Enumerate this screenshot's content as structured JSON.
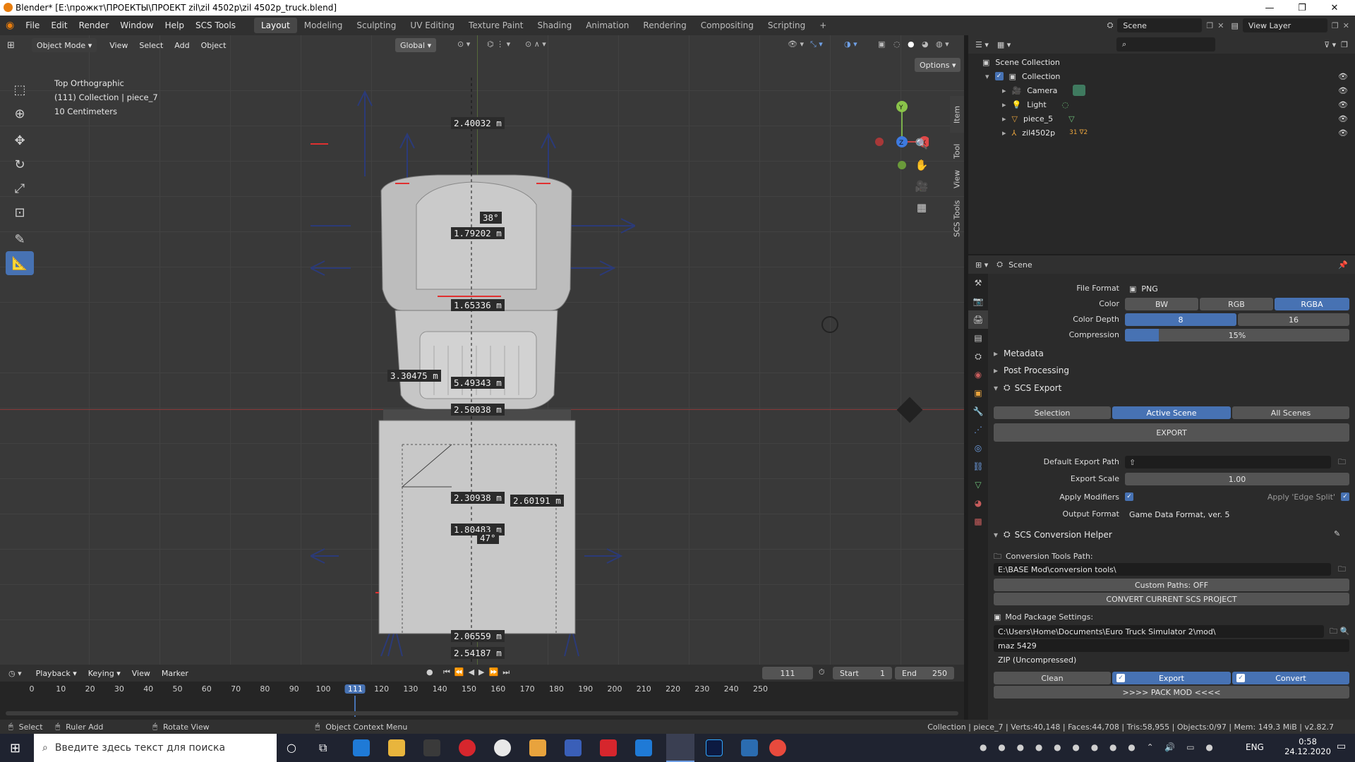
{
  "window": {
    "title": "Blender* [E:\\прожкт\\ПРОЕКТЫ\\ПРОЕКТ zil\\zil 4502p\\zil 4502p_truck.blend]",
    "minimize": "—",
    "maximize": "❐",
    "close": "✕"
  },
  "menu": [
    "File",
    "Edit",
    "Render",
    "Window",
    "Help",
    "SCS Tools"
  ],
  "workspaces": [
    "Layout",
    "Modeling",
    "Sculpting",
    "UV Editing",
    "Texture Paint",
    "Shading",
    "Animation",
    "Rendering",
    "Compositing",
    "Scripting"
  ],
  "topright": {
    "scene": "Scene",
    "view_layer": "View Layer"
  },
  "viewport": {
    "mode": "Object Mode",
    "menu": [
      "View",
      "Select",
      "Add",
      "Object"
    ],
    "orientation": "Global",
    "options": "Options",
    "info_line1": "Top Orthographic",
    "info_line2": "(111) Collection | piece_7",
    "info_line3": "10 Centimeters",
    "measurements": [
      "2.40032 m",
      "1.79202 m",
      "1.65336 m",
      "3.30475 m",
      "5.49343 m",
      "2.50038 m",
      "2.30938 m",
      "2.60191 m",
      "1.80483 m",
      "2.06559 m",
      "2.54187 m"
    ],
    "angle1": "38°",
    "angle2": "47°",
    "gizmo": {
      "y": "Y",
      "z": "Z",
      "x": "X"
    },
    "side_tabs": [
      "Item",
      "Tool",
      "View",
      "SCS Tools"
    ]
  },
  "timeline": {
    "menu": [
      "Playback",
      "Keying",
      "View",
      "Marker"
    ],
    "current_frame": "111",
    "start_label": "Start",
    "start": "1",
    "end_label": "End",
    "end": "250",
    "ticks": [
      "0",
      "10",
      "20",
      "30",
      "40",
      "50",
      "60",
      "70",
      "80",
      "90",
      "100",
      "111",
      "120",
      "130",
      "140",
      "150",
      "160",
      "170",
      "180",
      "190",
      "200",
      "210",
      "220",
      "230",
      "240",
      "250"
    ]
  },
  "statusbar": {
    "select": "Select",
    "ruler": "Ruler Add",
    "rotate": "Rotate View",
    "context": "Object Context Menu",
    "stats": "Collection | piece_7 | Verts:40,148 | Faces:44,708 | Tris:58,955 | Objects:0/97 | Mem: 149.3 MiB | v2.82.7"
  },
  "outliner": {
    "root": "Scene Collection",
    "collection": "Collection",
    "items": [
      "Camera",
      "Light",
      "piece_5",
      "zil4502p"
    ],
    "badge": "31 ∇2"
  },
  "properties": {
    "header": "Scene",
    "file_format_label": "File Format",
    "file_format": "PNG",
    "color_label": "Color",
    "color_options": [
      "BW",
      "RGB",
      "RGBA"
    ],
    "depth_label": "Color Depth",
    "depth_options": [
      "8",
      "16"
    ],
    "compression_label": "Compression",
    "compression": "15%",
    "compression_fraction": 0.15,
    "sections": {
      "metadata": "Metadata",
      "post": "Post Processing",
      "scs_export": "SCS Export",
      "conversion": "SCS Conversion Helper"
    },
    "scope": [
      "Selection",
      "Active Scene",
      "All Scenes"
    ],
    "export_button": "EXPORT",
    "default_path_label": "Default Export Path",
    "export_scale_label": "Export Scale",
    "export_scale": "1.00",
    "apply_modifiers": "Apply Modifiers",
    "apply_edge_split": "Apply 'Edge Split'",
    "output_format_label": "Output Format",
    "output_format": "Game Data Format, ver. 5",
    "conv_tools_label": "Conversion Tools Path:",
    "conv_tools_path": "E:\\BASE Mod\\conversion tools\\",
    "custom_paths": "Custom Paths: OFF",
    "convert_project": "CONVERT CURRENT SCS PROJECT",
    "mod_pkg_label": "Mod Package Settings:",
    "mod_path": "C:\\Users\\Home\\Documents\\Euro Truck Simulator 2\\mod\\",
    "mod_name": "maz 5429",
    "zip_mode": "ZIP (Uncompressed)",
    "clean": "Clean",
    "export": "Export",
    "convert": "Convert",
    "pack_mod": ">>>>   PACK MOD   <<<<"
  },
  "taskbar": {
    "search_placeholder": "Введите здесь текст для поиска",
    "lang": "ENG",
    "time": "0:58",
    "date": "24.12.2020"
  }
}
